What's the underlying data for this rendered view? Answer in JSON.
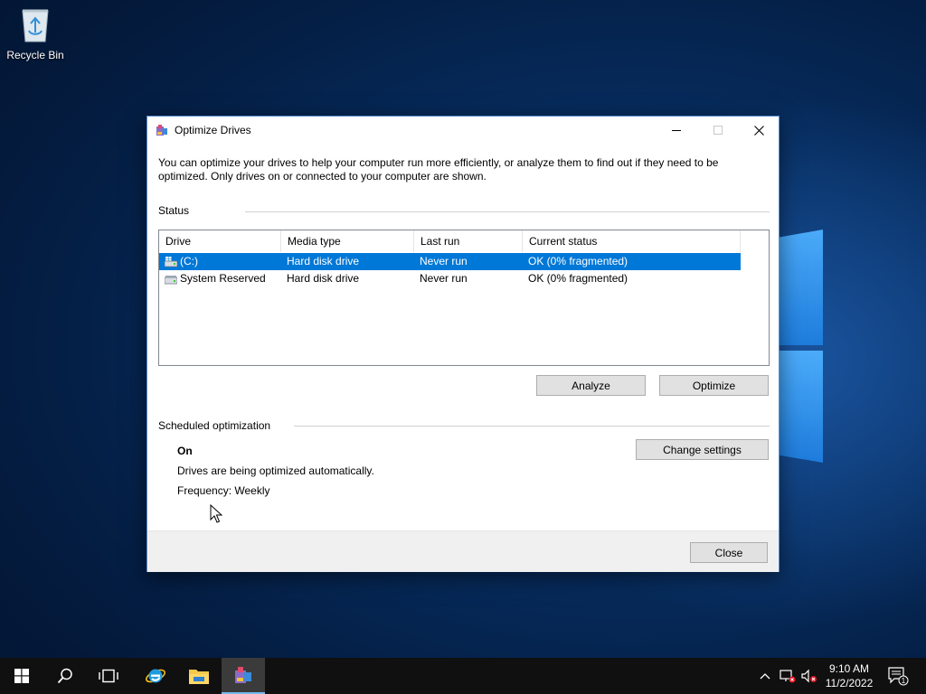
{
  "desktop": {
    "recycle_bin_label": "Recycle Bin"
  },
  "window": {
    "title": "Optimize Drives",
    "intro": "You can optimize your drives to help your computer run more efficiently, or analyze them to find out if they need to be optimized. Only drives on or connected to your computer are shown.",
    "status_label": "Status",
    "columns": [
      "Drive",
      "Media type",
      "Last run",
      "Current status"
    ],
    "drives": [
      {
        "drive": "(C:)",
        "media": "Hard disk drive",
        "last_run": "Never run",
        "status": "OK (0% fragmented)",
        "selected": true
      },
      {
        "drive": "System Reserved",
        "media": "Hard disk drive",
        "last_run": "Never run",
        "status": "OK (0% fragmented)",
        "selected": false
      }
    ],
    "analyze_label": "Analyze",
    "optimize_label": "Optimize",
    "scheduled_label": "Scheduled optimization",
    "schedule_state": "On",
    "schedule_desc": "Drives are being optimized automatically.",
    "schedule_frequency": "Frequency: Weekly",
    "change_settings_label": "Change settings",
    "close_label": "Close"
  },
  "taskbar": {
    "time": "9:10 AM",
    "date": "11/2/2022",
    "notification_count": "1"
  },
  "colors": {
    "accent": "#0078d7",
    "taskbar": "#101010"
  }
}
